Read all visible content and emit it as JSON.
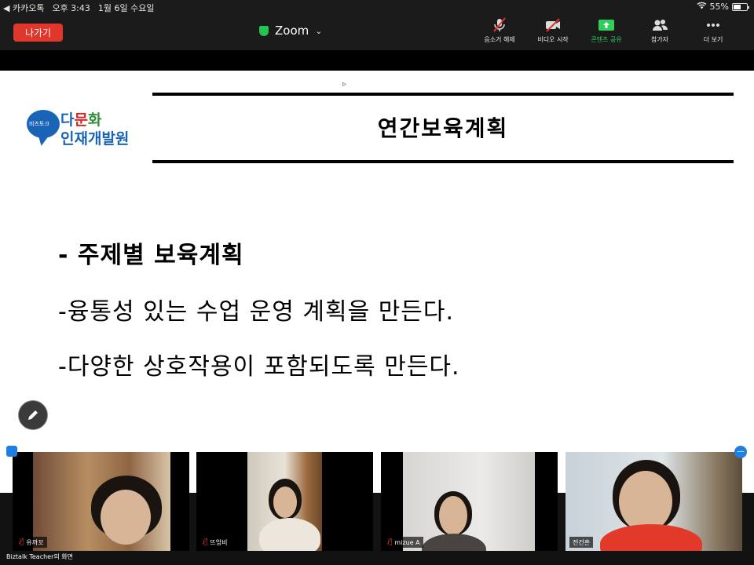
{
  "status_bar": {
    "back_app": "◀ 카카오톡",
    "time": "오후 3:43",
    "date": "1월 6일 수요일",
    "battery": "55%",
    "battery_level": 0.55
  },
  "toolbar": {
    "leave_label": "나가기",
    "app_title": "Zoom",
    "items": [
      {
        "label": "음소거 해제",
        "icon": "mic-off-icon"
      },
      {
        "label": "비디오 시작",
        "icon": "video-off-icon"
      },
      {
        "label": "콘텐츠 공유",
        "icon": "share-screen-icon"
      },
      {
        "label": "참가자",
        "icon": "participants-icon"
      },
      {
        "label": "더 보기",
        "icon": "more-icon"
      }
    ],
    "colors": {
      "leave": "#e0362b",
      "share": "#2ed05a",
      "secure": "#23c552"
    }
  },
  "slide": {
    "logo": {
      "badge": "비즈토크",
      "line1_a": "다",
      "line1_b": "문",
      "line1_c": "화",
      "line2": "인재개발원"
    },
    "title": "연간보육계획",
    "bullets": [
      "- 주제별 보육계획",
      "-융통성 있는 수업 운영 계획을 만든다.",
      "-다양한 상호작용이 포함되도록 만든다."
    ]
  },
  "participants": [
    {
      "name": "유까꼬",
      "muted": true
    },
    {
      "name": "뜨엉비",
      "muted": true
    },
    {
      "name": "mizue A",
      "muted": true
    },
    {
      "name": "전건흔",
      "muted": false
    }
  ],
  "screen_share_label": "Biztalk Teacher의 화면"
}
